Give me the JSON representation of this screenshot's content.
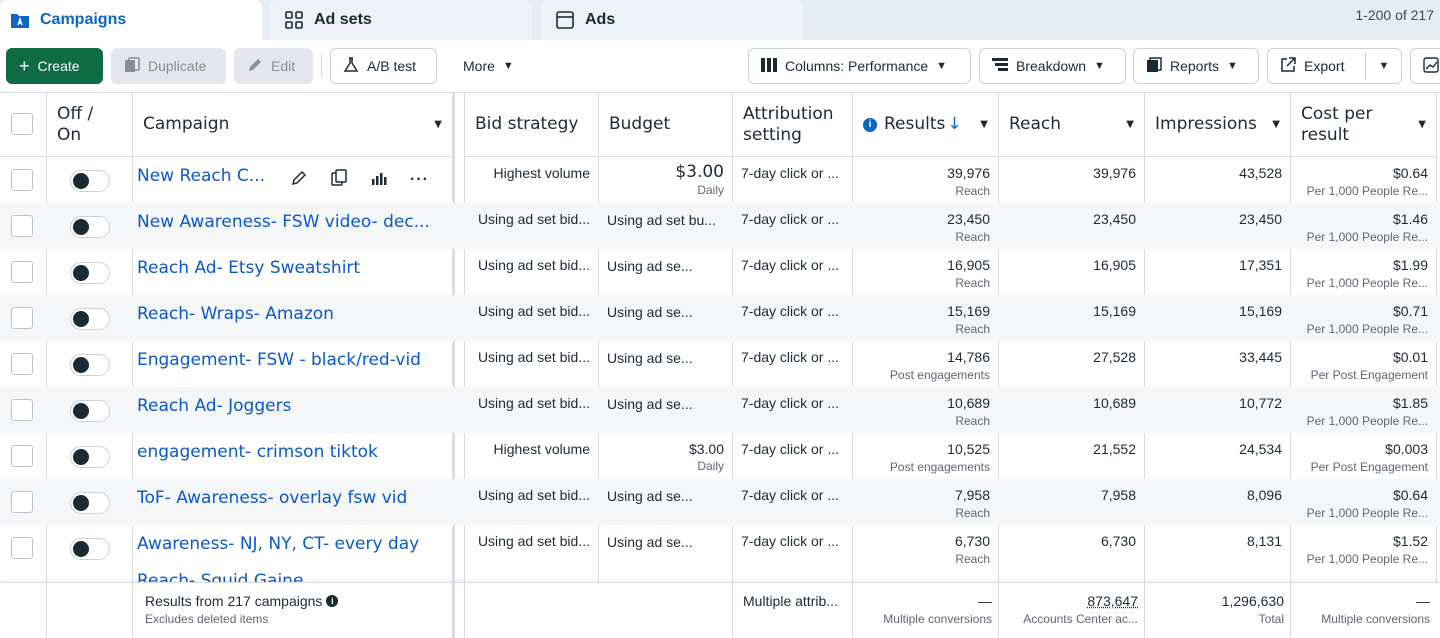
{
  "tabs": [
    {
      "label": "Campaigns",
      "icon": "campaigns-folder-icon"
    },
    {
      "label": "Ad sets",
      "icon": "grid-icon"
    },
    {
      "label": "Ads",
      "icon": "ad-window-icon"
    }
  ],
  "pagination": "1-200 of 217",
  "toolbar": {
    "create": "Create",
    "duplicate": "Duplicate",
    "edit": "Edit",
    "ab_test": "A/B test",
    "more": "More",
    "columns": "Columns: Performance",
    "breakdown": "Breakdown",
    "reports": "Reports",
    "export": "Export"
  },
  "headers": {
    "off_on": "Off / On",
    "campaign": "Campaign",
    "bid_strategy": "Bid strategy",
    "budget": "Budget",
    "attribution": "Attribution setting",
    "results": "Results",
    "reach": "Reach",
    "impressions": "Impressions",
    "cost": "Cost per result"
  },
  "rows": [
    {
      "name": "New Reach C...",
      "bid": "Highest volume",
      "budget": "$3.00",
      "budget_sub": "Daily",
      "attr": "7-day click or ...",
      "results": "39,976",
      "results_sub": "Reach",
      "reach": "39,976",
      "impr": "43,528",
      "cost": "$0.64",
      "cost_sub": "Per 1,000 People Re..."
    },
    {
      "name": "New Awareness- FSW video- dec...",
      "bid": "Using ad set bid...",
      "budget": "Using ad set bu...",
      "budget_sub": "",
      "attr": "7-day click or ...",
      "results": "23,450",
      "results_sub": "Reach",
      "reach": "23,450",
      "impr": "23,450",
      "cost": "$1.46",
      "cost_sub": "Per 1,000 People Re..."
    },
    {
      "name": "Reach Ad- Etsy Sweatshirt",
      "bid": "Using ad set bid...",
      "budget": "Using ad se...",
      "budget_sub": "",
      "attr": "7-day click or ...",
      "results": "16,905",
      "results_sub": "Reach",
      "reach": "16,905",
      "impr": "17,351",
      "cost": "$1.99",
      "cost_sub": "Per 1,000 People Re..."
    },
    {
      "name": "Reach- Wraps- Amazon",
      "bid": "Using ad set bid...",
      "budget": "Using ad se...",
      "budget_sub": "",
      "attr": "7-day click or ...",
      "results": "15,169",
      "results_sub": "Reach",
      "reach": "15,169",
      "impr": "15,169",
      "cost": "$0.71",
      "cost_sub": "Per 1,000 People Re..."
    },
    {
      "name": "Engagement- FSW - black/red-vid",
      "bid": "Using ad set bid...",
      "budget": "Using ad se...",
      "budget_sub": "",
      "attr": "7-day click or ...",
      "results": "14,786",
      "results_sub": "Post engagements",
      "reach": "27,528",
      "impr": "33,445",
      "cost": "$0.01",
      "cost_sub": "Per Post Engagement"
    },
    {
      "name": "Reach Ad- Joggers",
      "bid": "Using ad set bid...",
      "budget": "Using ad se...",
      "budget_sub": "",
      "attr": "7-day click or ...",
      "results": "10,689",
      "results_sub": "Reach",
      "reach": "10,689",
      "impr": "10,772",
      "cost": "$1.85",
      "cost_sub": "Per 1,000 People Re..."
    },
    {
      "name": "engagement- crimson tiktok",
      "bid": "Highest volume",
      "budget": "$3.00",
      "budget_sub": "Daily",
      "attr": "7-day click or ...",
      "results": "10,525",
      "results_sub": "Post engagements",
      "reach": "21,552",
      "impr": "24,534",
      "cost": "$0.003",
      "cost_sub": "Per Post Engagement"
    },
    {
      "name": "ToF- Awareness- overlay fsw vid",
      "bid": "Using ad set bid...",
      "budget": "Using ad se...",
      "budget_sub": "",
      "attr": "7-day click or ...",
      "results": "7,958",
      "results_sub": "Reach",
      "reach": "7,958",
      "impr": "8,096",
      "cost": "$0.64",
      "cost_sub": "Per 1,000 People Re..."
    },
    {
      "name": "Awareness- NJ, NY, CT- every day",
      "bid": "Using ad set bid...",
      "budget": "Using ad se...",
      "budget_sub": "",
      "attr": "7-day click or ...",
      "results": "6,730",
      "results_sub": "Reach",
      "reach": "6,730",
      "impr": "8,131",
      "cost": "$1.52",
      "cost_sub": "Per 1,000 People Re..."
    }
  ],
  "footer": {
    "title": "Results from 217 campaigns",
    "subtitle": "Excludes deleted items",
    "attr": "Multiple attrib...",
    "results": "—",
    "results_sub": "Multiple conversions",
    "reach": "873,647",
    "reach_sub": "Accounts Center ac...",
    "impr": "1,296,630",
    "impr_sub": "Total",
    "cost": "—",
    "cost_sub": "Multiple conversions"
  },
  "colors": {
    "accent": "#0a58ca",
    "create": "#0e6b46",
    "toggle_knob": "#1c2b33"
  }
}
